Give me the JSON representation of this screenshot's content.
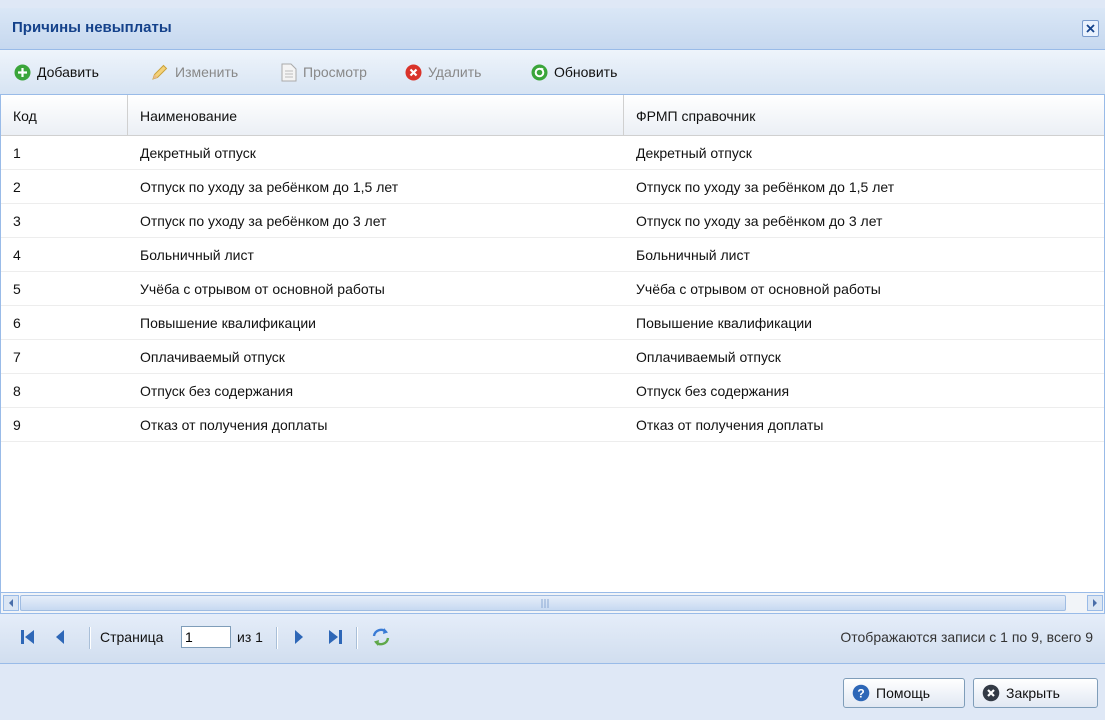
{
  "window": {
    "title": "Причины невыплаты"
  },
  "toolbar": {
    "add_label": "Добавить",
    "edit_label": "Изменить",
    "view_label": "Просмотр",
    "delete_label": "Удалить",
    "refresh_label": "Обновить"
  },
  "grid": {
    "columns": [
      "Код",
      "Наименование",
      "ФРМП справочник"
    ],
    "rows": [
      {
        "code": "1",
        "name": "Декретный отпуск",
        "frmp": "Декретный отпуск"
      },
      {
        "code": "2",
        "name": "Отпуск по уходу за ребёнком до 1,5 лет",
        "frmp": "Отпуск по уходу за ребёнком до 1,5 лет"
      },
      {
        "code": "3",
        "name": "Отпуск по уходу за ребёнком до 3 лет",
        "frmp": "Отпуск по уходу за ребёнком до 3 лет"
      },
      {
        "code": "4",
        "name": "Больничный лист",
        "frmp": "Больничный лист"
      },
      {
        "code": "5",
        "name": "Учёба с отрывом от основной работы",
        "frmp": "Учёба с отрывом от основной работы"
      },
      {
        "code": "6",
        "name": "Повышение квалификации",
        "frmp": "Повышение квалификации"
      },
      {
        "code": "7",
        "name": "Оплачиваемый отпуск",
        "frmp": "Оплачиваемый отпуск"
      },
      {
        "code": "8",
        "name": "Отпуск без содержания",
        "frmp": "Отпуск без содержания"
      },
      {
        "code": "9",
        "name": "Отказ от получения доплаты",
        "frmp": "Отказ от получения доплаты"
      }
    ]
  },
  "paging": {
    "page_label": "Страница",
    "page_value": "1",
    "of_label": "из 1",
    "display_info": "Отображаются записи с 1 по 9, всего 9"
  },
  "footer": {
    "help_label": "Помощь",
    "close_label": "Закрыть"
  },
  "colors": {
    "title_text": "#15428b",
    "header_bg": "#dfe8f6",
    "border": "#99bbe8",
    "add_icon": "#3aa53a",
    "delete_icon": "#d9332a",
    "refresh_icon": "#3aa53a",
    "help_icon": "#2e67b7"
  },
  "icons": {
    "add": "plus-circle-icon",
    "edit": "pencil-icon",
    "view": "document-icon",
    "delete": "x-circle-icon",
    "refresh": "refresh-icon",
    "close": "close-icon",
    "help": "question-circle-icon",
    "close_button": "x-circle-icon"
  }
}
